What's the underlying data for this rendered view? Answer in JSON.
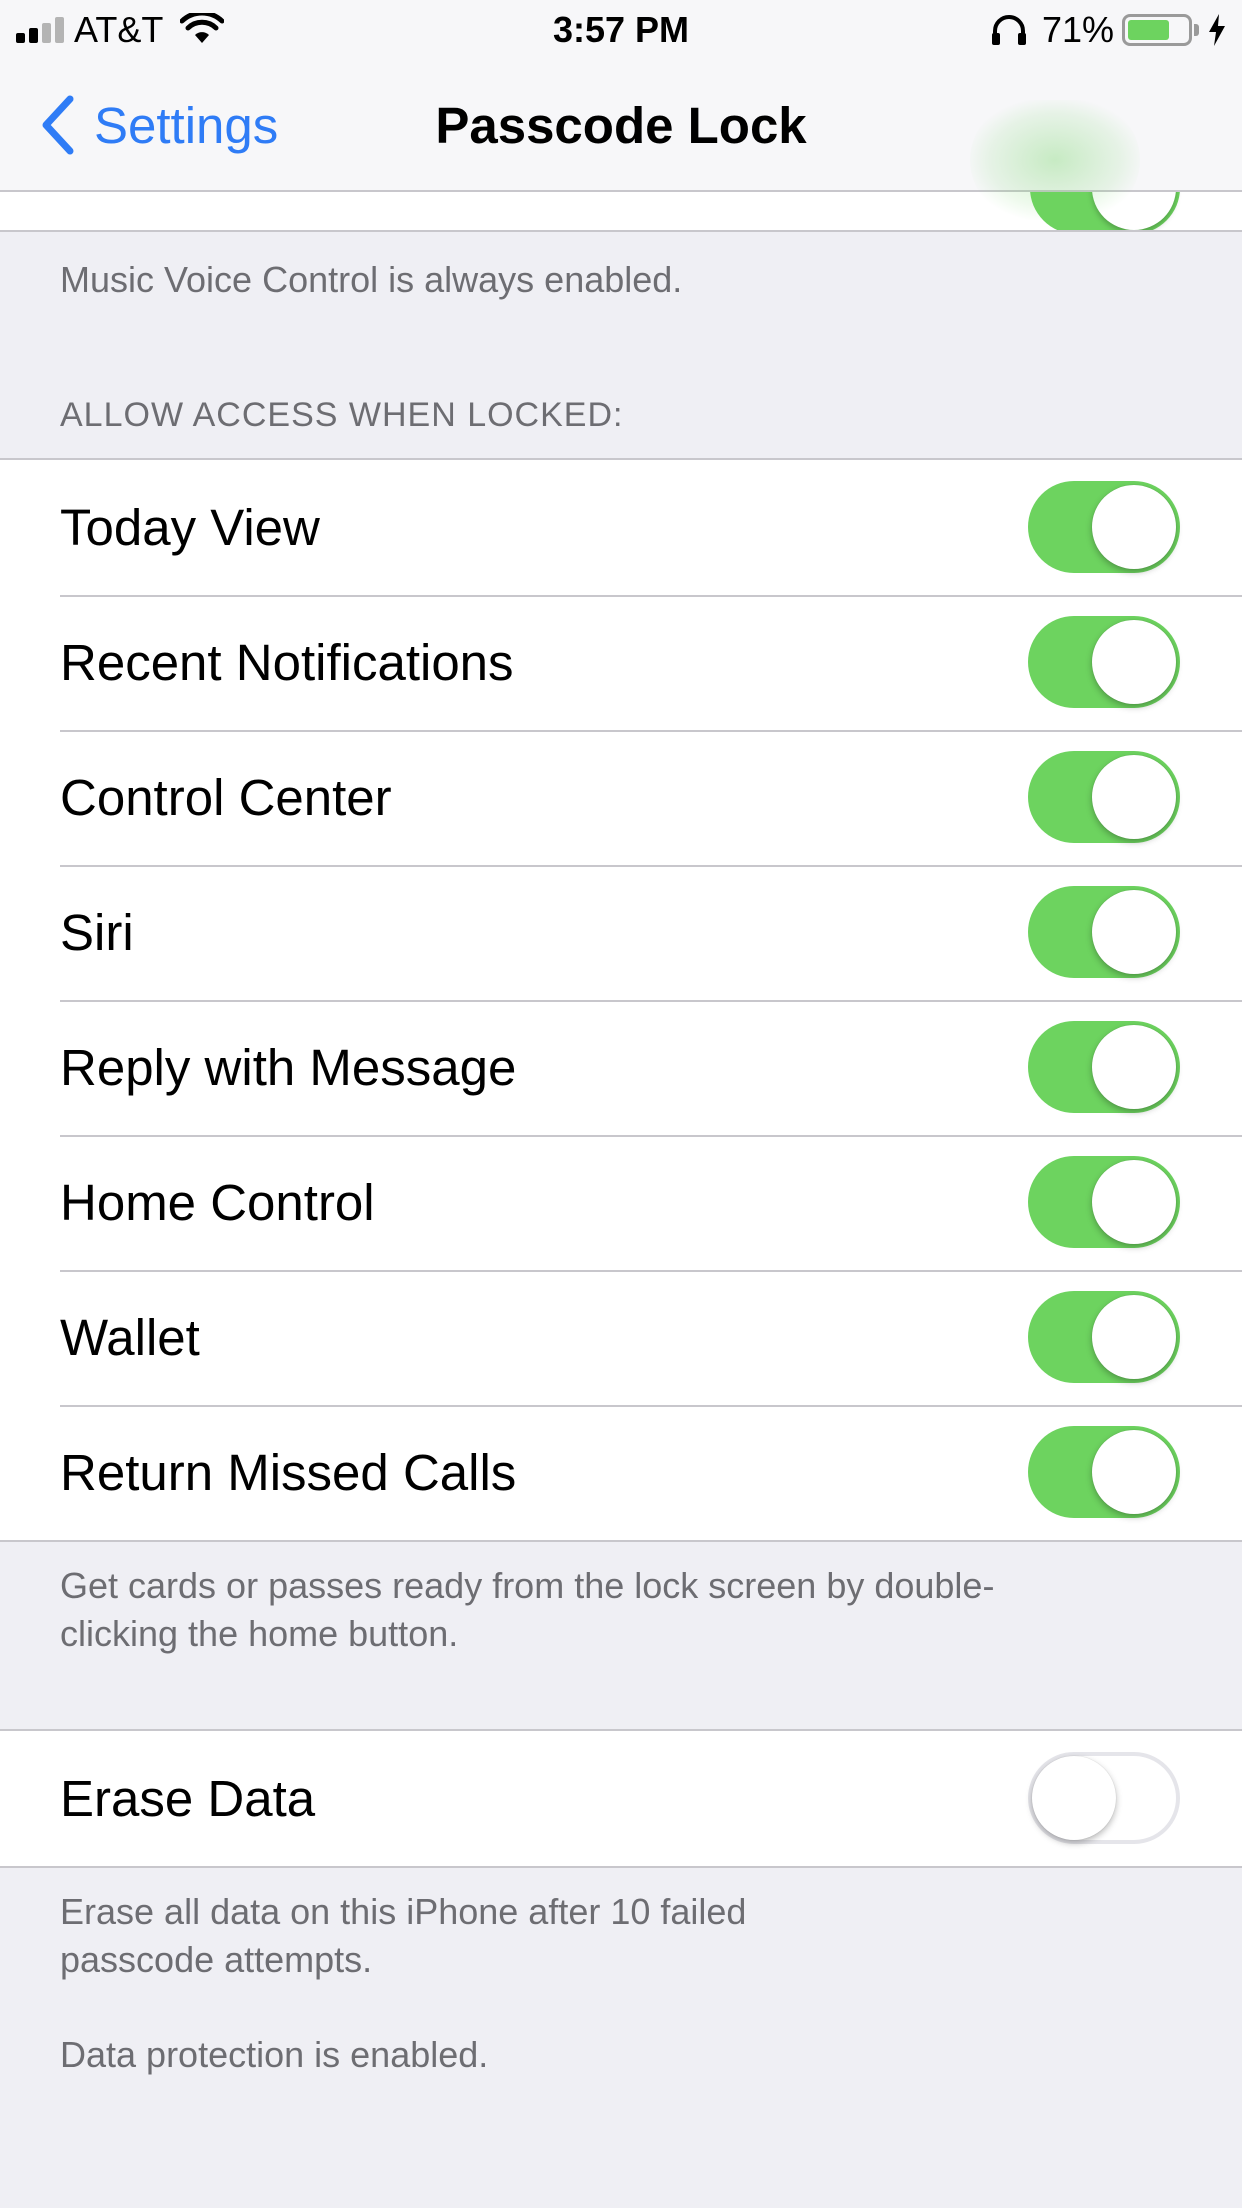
{
  "status_bar": {
    "carrier": "AT&T",
    "time": "3:57 PM",
    "battery_percent": "71%",
    "battery_level": 0.71,
    "signal_bars": 2,
    "charging": true
  },
  "nav": {
    "back_label": "Settings",
    "title": "Passcode Lock"
  },
  "music_voice_note": "Music Voice Control is always enabled.",
  "allow_access": {
    "header": "ALLOW ACCESS WHEN LOCKED:",
    "items": [
      {
        "label": "Today View",
        "enabled": true
      },
      {
        "label": "Recent Notifications",
        "enabled": true
      },
      {
        "label": "Control Center",
        "enabled": true
      },
      {
        "label": "Siri",
        "enabled": true
      },
      {
        "label": "Reply with Message",
        "enabled": true
      },
      {
        "label": "Home Control",
        "enabled": true
      },
      {
        "label": "Wallet",
        "enabled": true
      },
      {
        "label": "Return Missed Calls",
        "enabled": true
      }
    ],
    "footer_line1": "Get cards or passes ready from the lock screen by double-",
    "footer_line2": "clicking the home button."
  },
  "erase_data": {
    "label": "Erase Data",
    "enabled": false,
    "footer_line1": "Erase all data on this iPhone after 10 failed",
    "footer_line2": "passcode attempts.",
    "protection_note": "Data protection is enabled."
  },
  "colors": {
    "toggle_on": "#6dd35f",
    "link_blue": "#2f7cf6",
    "secondary_text": "#6d6d72",
    "grouped_background": "#efeff4"
  }
}
